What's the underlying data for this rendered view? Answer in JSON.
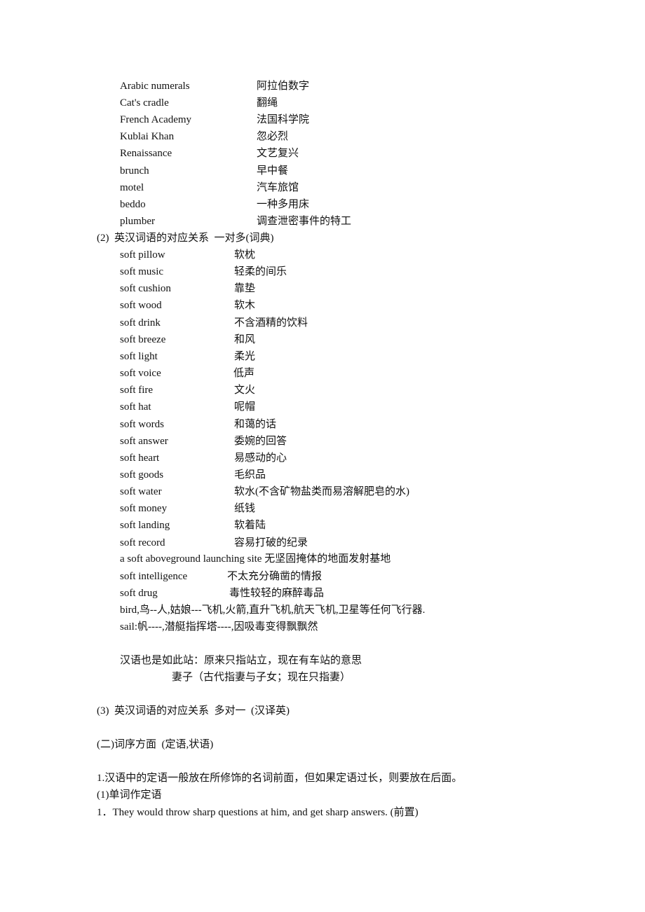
{
  "section1_items": [
    {
      "en": "Arabic numerals",
      "zh": "阿拉伯数字"
    },
    {
      "en": "Cat's cradle",
      "zh": "翻绳"
    },
    {
      "en": "French Academy",
      "zh": "法国科学院"
    },
    {
      "en": "Kublai Khan",
      "zh": "忽必烈"
    },
    {
      "en": "Renaissance",
      "zh": "文艺复兴"
    },
    {
      "en": "brunch",
      "zh": "早中餐"
    },
    {
      "en": "motel",
      "zh": "汽车旅馆"
    },
    {
      "en": "beddo",
      "zh": "一种多用床"
    },
    {
      "en": "plumber",
      "zh": "调查泄密事件的特工"
    }
  ],
  "heading2": "(2)  英汉词语的对应关系  一对多(词典)",
  "section2_items": [
    {
      "en": "soft pillow",
      "zh": "软枕"
    },
    {
      "en": "soft music",
      "zh": "轻柔的间乐"
    },
    {
      "en": "soft cushion",
      "zh": "靠垫"
    },
    {
      "en": "soft wood",
      "zh": "软木"
    },
    {
      "en": "soft drink",
      "zh": "不含酒精的饮料"
    },
    {
      "en": "soft breeze",
      "zh": "和风"
    },
    {
      "en": "soft light",
      "zh": "柔光"
    },
    {
      "en": "soft voice",
      "zh": "低声"
    },
    {
      "en": "soft fire",
      "zh": "文火"
    },
    {
      "en": "soft hat",
      "zh": "呢帽"
    },
    {
      "en": "soft words",
      "zh": "和蔼的话"
    },
    {
      "en": "soft answer",
      "zh": "委婉的回答"
    },
    {
      "en": "soft heart",
      "zh": "易感动的心"
    },
    {
      "en": "soft goods",
      "zh": "毛织品"
    },
    {
      "en": "soft water",
      "zh": "软水(不含矿物盐类而易溶解肥皂的水)"
    },
    {
      "en": "soft money",
      "zh": "纸钱"
    },
    {
      "en": "soft landing",
      "zh": "软着陆"
    },
    {
      "en": "soft record",
      "zh": "容易打破的纪录"
    }
  ],
  "launch_site": "a soft aboveground launching site 无坚固掩体的地面发射基地",
  "intelligence": {
    "en": "soft intelligence",
    "zh": "不太充分确凿的情报"
  },
  "drug": {
    "en": "soft drug",
    "zh": "毒性较轻的麻醉毒品"
  },
  "bird_line": "bird,鸟--人,姑娘---飞机,火箭,直升飞机,航天飞机,卫星等任何飞行器.",
  "sail_line": "sail:帆----,潜艇指挥塔----,因吸毒变得飘飘然",
  "chinese_note1": "汉语也是如此站：原来只指站立，现在有车站的意思",
  "chinese_note2": "妻子（古代指妻与子女；现在只指妻）",
  "heading3": "(3)  英汉词语的对应关系  多对一  (汉译英)",
  "heading_word_order": "(二)词序方面  (定语,状语)",
  "rule1": "1.汉语中的定语一般放在所修饰的名词前面，但如果定语过长，则要放在后面。",
  "sub1": "(1)单词作定语",
  "example1": "1．They would throw sharp questions at him, and get sharp answers. (前置)"
}
